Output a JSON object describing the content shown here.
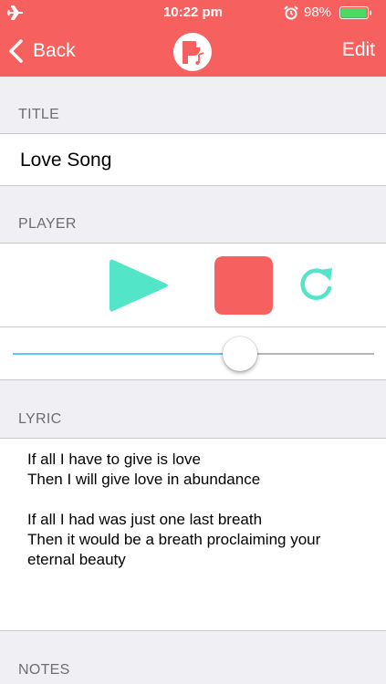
{
  "status_bar": {
    "time": "10:22 pm",
    "battery_percent": "98%",
    "airplane_icon": "airplane-icon",
    "alarm_icon": "alarm-icon",
    "battery_icon": "battery-icon",
    "battery_level": 0.98,
    "battery_color": "#4cd964"
  },
  "nav": {
    "back_label": "Back",
    "edit_label": "Edit",
    "logo_icon": "app-logo-icon",
    "bar_color": "#f6605e"
  },
  "sections": {
    "title_header": "TITLE",
    "player_header": "PLAYER",
    "lyric_header": "LYRIC",
    "notes_header": "NOTES"
  },
  "song": {
    "title": "Love Song",
    "lyric_lines": [
      "If all I have to give is love",
      "Then I will give love in abundance",
      "",
      "If all I had was just one last breath",
      "Then it would be a breath proclaiming your",
      "eternal beauty"
    ]
  },
  "player": {
    "play_icon": "play-icon",
    "stop_icon": "stop-icon",
    "repeat_icon": "repeat-icon",
    "progress": 0.63,
    "play_color": "#52e5c7",
    "stop_color": "#f6605e",
    "slider_fill_color": "#5ac8fa"
  }
}
